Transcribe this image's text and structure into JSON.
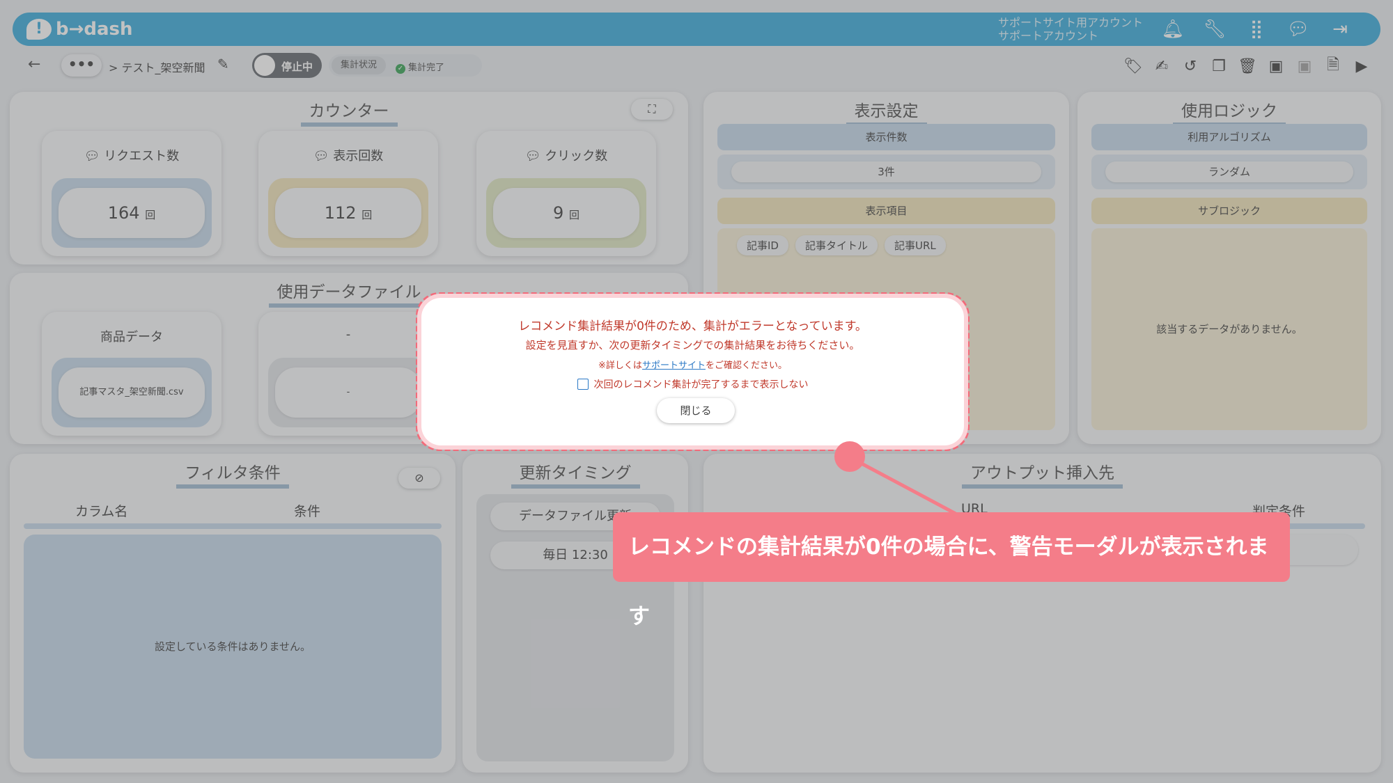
{
  "header": {
    "brand": "b→dash",
    "account_line1": "サポートサイト用アカウント",
    "account_line2": "サポートアカウント",
    "icons": [
      "bell-icon",
      "wrench-icon",
      "grid-icon",
      "chat-icon",
      "logout-icon"
    ]
  },
  "toolbar": {
    "back": "←",
    "more": "•••",
    "breadcrumb": "> テスト_架空新聞",
    "toggle_label": "停止中",
    "status_left": "集計状況",
    "status_right": "集計完了",
    "icons": [
      "tag-icon",
      "edit-icon",
      "history-icon",
      "copy-icon",
      "trash-icon",
      "archive-icon",
      "archive-disabled-icon",
      "document-icon",
      "play-icon"
    ]
  },
  "counter": {
    "title": "カウンター",
    "expand_icon": "expand-icon",
    "unit": "回",
    "items": [
      {
        "label": "リクエスト数",
        "value": "164",
        "color": "#c2d6e8"
      },
      {
        "label": "表示回数",
        "value": "112",
        "color": "#f0e2b5"
      },
      {
        "label": "クリック数",
        "value": "9",
        "color": "#dde5be"
      }
    ]
  },
  "data_files": {
    "title": "使用データファイル",
    "items": [
      {
        "label": "商品データ",
        "value": "記事マスタ_架空新聞.csv"
      },
      {
        "label": "-",
        "value": "-"
      }
    ]
  },
  "display_settings": {
    "title": "表示設定",
    "count_label": "表示件数",
    "count_value": "3件",
    "items_label": "表示項目",
    "items": [
      "記事ID",
      "記事タイトル",
      "記事URL"
    ]
  },
  "logic": {
    "title": "使用ロジック",
    "algo_label": "利用アルゴリズム",
    "algo_value": "ランダム",
    "sub_label": "サブロジック",
    "sub_empty": "該当するデータがありません。"
  },
  "filter": {
    "title": "フィルタ条件",
    "col1": "カラム名",
    "col2": "条件",
    "empty": "設定している条件はありません。"
  },
  "timing": {
    "title": "更新タイミング",
    "item1": "データファイル更新",
    "item2": "毎日 12:30"
  },
  "output": {
    "title": "アウトプット挿入先",
    "col1": "URL",
    "col2": "判定条件"
  },
  "modal": {
    "line1": "レコメンド集計結果が0件のため、集計がエラーとなっています。",
    "line2": "設定を見直すか、次の更新タイミングでの集計結果をお待ちください。",
    "line3_prefix": "※詳しくは",
    "line3_link": "サポートサイト",
    "line3_suffix": "をご確認ください。",
    "checkbox_label": "次回のレコメンド集計が完了するまで表示しない",
    "close": "閉じる"
  },
  "annotation": {
    "text": "レコメンドの集計結果が0件の場合に、警告モーダルが表示されます",
    "color": "#f47d89"
  }
}
